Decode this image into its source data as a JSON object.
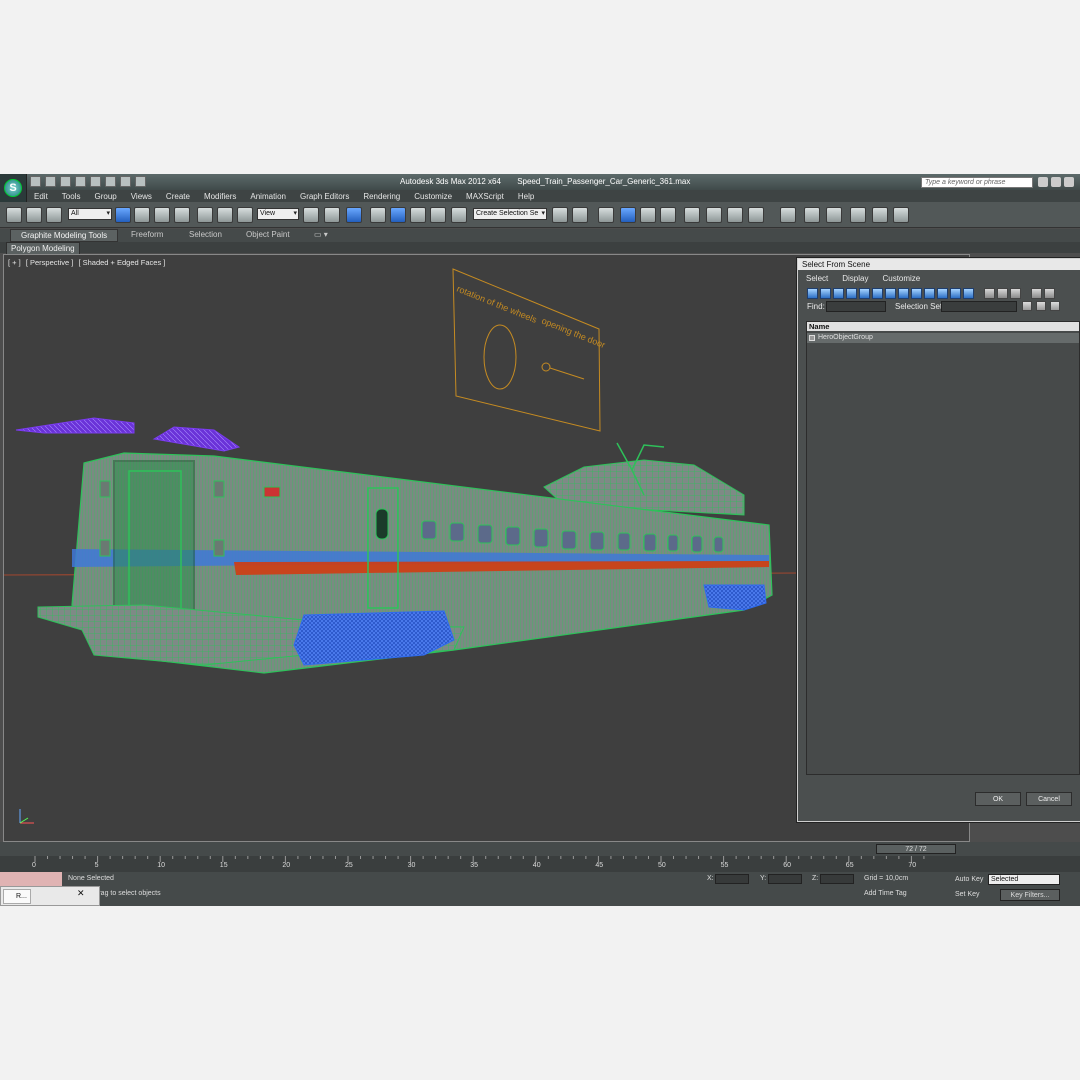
{
  "window": {
    "app_name": "Autodesk 3ds Max  2012 x64",
    "file_name": "Speed_Train_Passenger_Car_Generic_361.max",
    "search_placeholder": "Type a keyword or phrase"
  },
  "menu": [
    "Edit",
    "Tools",
    "Group",
    "Views",
    "Create",
    "Modifiers",
    "Animation",
    "Graph Editors",
    "Rendering",
    "Customize",
    "MAXScript",
    "Help"
  ],
  "toolbar": {
    "filter_value": "All",
    "ref_coord_value": "View",
    "selection_set_value": "Create Selection Se"
  },
  "ribbon": {
    "tabs": [
      "Graphite Modeling Tools",
      "Freeform",
      "Selection",
      "Object Paint"
    ],
    "panel_label": "Polygon Modeling"
  },
  "viewport": {
    "label_plus": "[ + ]",
    "label_view": "[ Perspective ]",
    "label_shading": "[ Shaded + Edged Faces ]",
    "note_text_1": "rotation of the wheels",
    "note_text_2": "opening the door"
  },
  "dialog": {
    "title": "Select From Scene",
    "menu": [
      "Select",
      "Display",
      "Customize"
    ],
    "find_label": "Find:",
    "selection_set_label": "Selection Set:",
    "column_header": "Name",
    "items": [
      "HeroObjectGroup"
    ],
    "ok_label": "OK",
    "cancel_label": "Cancel"
  },
  "timeline": {
    "frame_indicator": "72 / 72",
    "ticks": [
      "0",
      "5",
      "10",
      "15",
      "20",
      "25",
      "30",
      "35",
      "40",
      "45",
      "50",
      "55",
      "60",
      "65",
      "70"
    ]
  },
  "status": {
    "selection": "None Selected",
    "prompt": "lick-and-drag to select objects",
    "x_label": "X:",
    "y_label": "Y:",
    "z_label": "Z:",
    "grid": "Grid = 10,0cm",
    "add_time_tag": "Add Time Tag",
    "auto_key": "Auto Key",
    "set_key": "Set Key",
    "selected_value": "Selected",
    "key_filters": "Key Filters..."
  },
  "taskbar": {
    "task_label": "R..."
  },
  "colors": {
    "viewport_bg": "#3f3f3f",
    "mesh_green": "#2ec15a",
    "mesh_blue": "#2f6cf0",
    "mesh_purple": "#7b3cf0",
    "stripe_red": "#d03c12",
    "stripe_blue": "#3f78d8",
    "active_button": "#2f6fd0"
  }
}
